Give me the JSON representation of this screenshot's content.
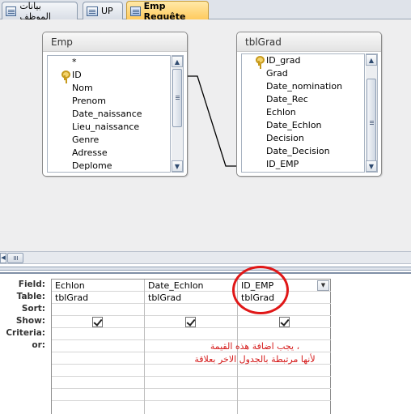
{
  "tabs": [
    {
      "label": "بيانات الموظف",
      "icon": "table-icon"
    },
    {
      "label": "UP",
      "icon": "table-icon"
    },
    {
      "label": "Emp Requête",
      "icon": "query-icon",
      "active": true
    }
  ],
  "tables": {
    "emp": {
      "title": "Emp",
      "fields": [
        "*",
        "ID",
        "Nom",
        "Prenom",
        "Date_naissance",
        "Lieu_naissance",
        "Genre",
        "Adresse",
        "Deplome"
      ],
      "key_field": "ID"
    },
    "tblgrad": {
      "title": "tblGrad",
      "fields": [
        "ID_grad",
        "Grad",
        "Date_nomination",
        "Date_Rec",
        "Echlon",
        "Date_Echlon",
        "Decision",
        "Date_Decision",
        "ID_EMP"
      ],
      "key_field": "ID_grad"
    }
  },
  "grid": {
    "row_labels": [
      "Field:",
      "Table:",
      "Sort:",
      "Show:",
      "Criteria:",
      "or:"
    ],
    "columns": [
      {
        "field": "Echlon",
        "table": "tblGrad",
        "show": true
      },
      {
        "field": "Date_Echlon",
        "table": "tblGrad",
        "show": true
      },
      {
        "field": "ID_EMP",
        "table": "tblGrad",
        "show": true
      }
    ]
  },
  "annotation": {
    "line1": "، يجب اضافة هذه القيمة",
    "line2": "لأنها مرتبطة بالجدول الاخر بعلاقة",
    "color": "#d51a1a"
  },
  "colors": {
    "active_tab": "#ffc95a",
    "design_bg": "#eeeeef"
  }
}
